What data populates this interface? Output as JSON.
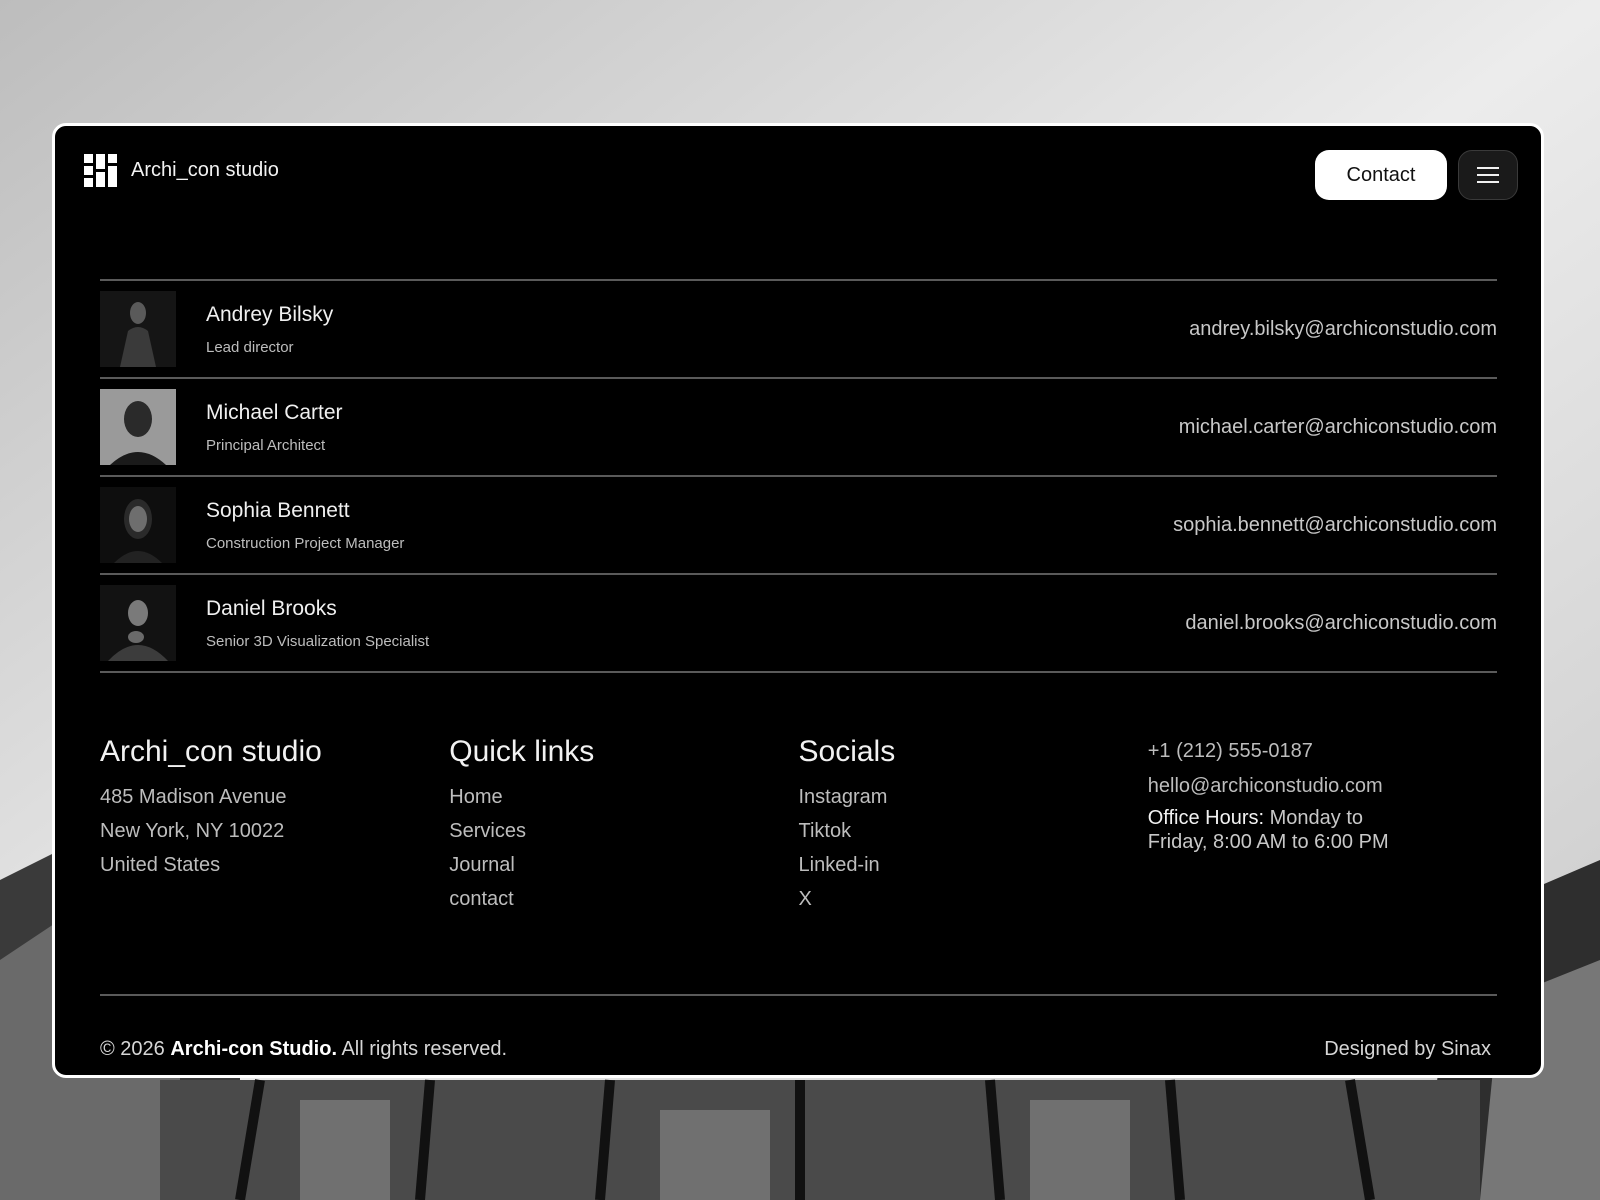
{
  "header": {
    "brand_name": "Archi_con studio",
    "contact_label": "Contact",
    "menu_icon": "hamburger-menu-icon"
  },
  "team": [
    {
      "name": "Andrey Bilsky",
      "role": "Lead director",
      "email": "andrey.bilsky@archiconstudio.com"
    },
    {
      "name": "Michael Carter",
      "role": "Principal Architect",
      "email": "michael.carter@archiconstudio.com"
    },
    {
      "name": "Sophia Bennett",
      "role": "Construction Project Manager",
      "email": "sophia.bennett@archiconstudio.com"
    },
    {
      "name": "Daniel Brooks",
      "role": "Senior 3D Visualization Specialist",
      "email": "daniel.brooks@archiconstudio.com"
    }
  ],
  "footer": {
    "studio": {
      "title": "Archi_con studio",
      "address": [
        "485 Madison Avenue",
        "New York, NY 10022",
        "United States"
      ]
    },
    "quick_links": {
      "title": "Quick links",
      "items": [
        "Home",
        "Services",
        "Journal",
        "contact"
      ]
    },
    "socials": {
      "title": "Socials",
      "items": [
        "Instagram",
        "Tiktok",
        "Linked-in",
        "X"
      ]
    },
    "contact": {
      "phone": "+1 (212) 555-0187",
      "email": "hello@archiconstudio.com",
      "hours_label": "Office Hours:",
      "hours_value": " Monday to Friday, 8:00 AM to 6:00 PM"
    },
    "copyright_prefix": "© 2026 ",
    "copyright_brand": "Archi-con Studio.",
    "copyright_suffix": " All rights reserved.",
    "credit": "Designed by Sinax"
  },
  "colors": {
    "card_bg": "#000000",
    "card_border": "#ffffff",
    "divider": "#5a5a5a",
    "button_bg": "#ffffff"
  }
}
